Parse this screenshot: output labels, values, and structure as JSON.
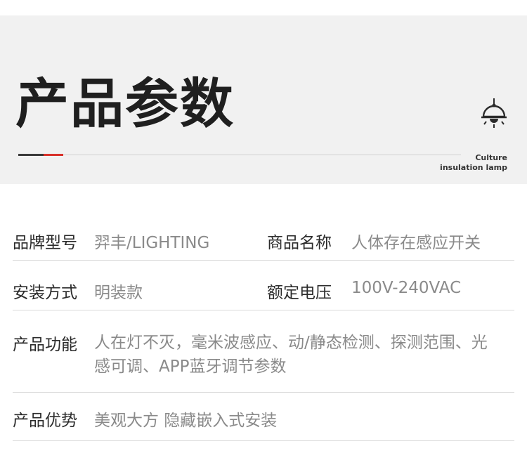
{
  "header": {
    "title": "产品参数",
    "tagline_line1": "Culture",
    "tagline_line2": "insulation lamp",
    "icon": "ceiling-lamp-icon",
    "accent_color": "#d8312a"
  },
  "specs": [
    {
      "label": "品牌型号",
      "value": "羿丰/LIGHTING"
    },
    {
      "label": "商品名称",
      "value": "人体存在感应开关"
    },
    {
      "label": "安装方式",
      "value": "明装款"
    },
    {
      "label": "额定电压",
      "value": "100V-240VAC"
    },
    {
      "label": "产品功能",
      "value": "人在灯不灭，毫米波感应、动/静态检测、探测范围、光感可调、APP蓝牙调节参数"
    },
    {
      "label": "产品优势",
      "value": "美观大方 隐藏嵌入式安装"
    }
  ]
}
